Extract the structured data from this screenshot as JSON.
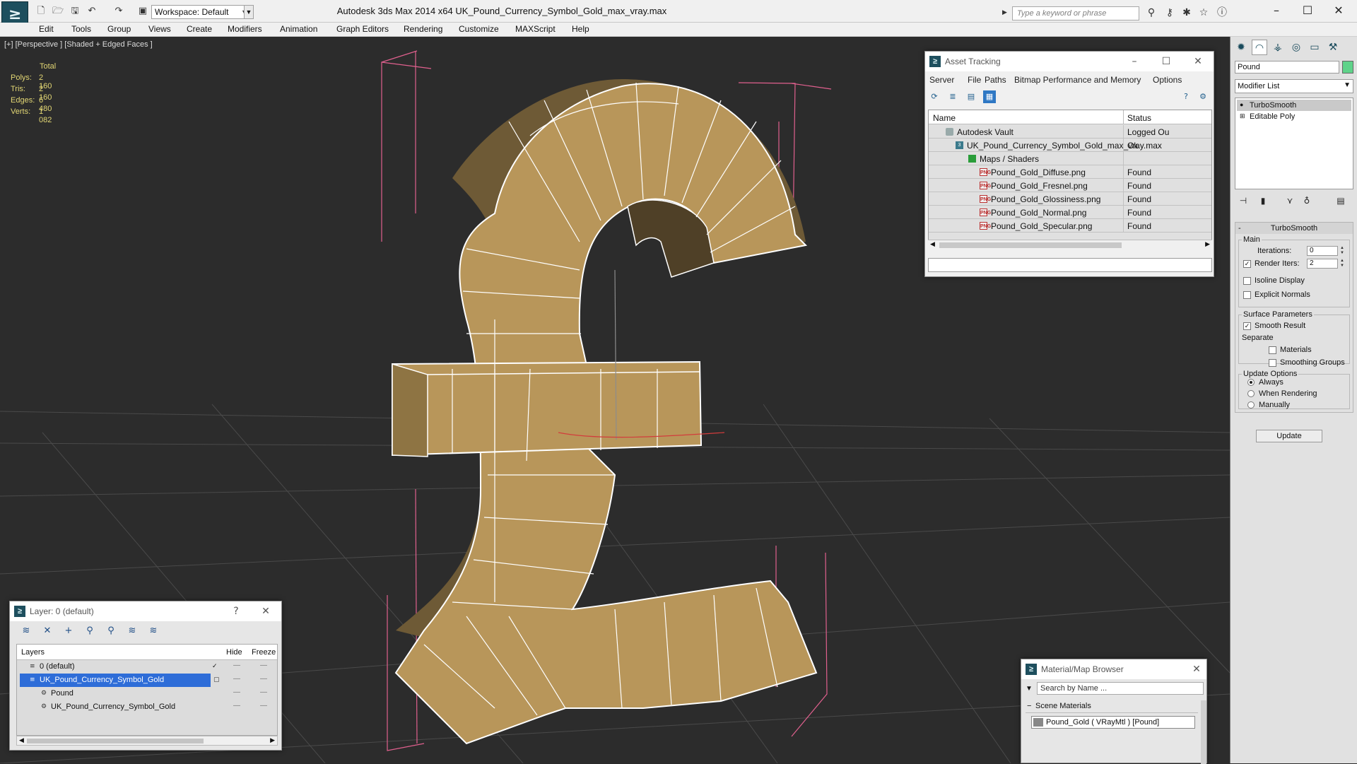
{
  "titlebar": {
    "workspace": "Workspace: Default",
    "title": "Autodesk 3ds Max  2014 x64      UK_Pound_Currency_Symbol_Gold_max_vray.max",
    "search_placeholder": "Type a keyword or phrase"
  },
  "menu": [
    "Edit",
    "Tools",
    "Group",
    "Views",
    "Create",
    "Modifiers",
    "Animation",
    "Graph Editors",
    "Rendering",
    "Customize",
    "MAXScript",
    "Help"
  ],
  "viewport": {
    "label": "[+] [Perspective ] [Shaded + Edged Faces ]",
    "stats": {
      "header": "Total",
      "rows": [
        {
          "key": "Polys:",
          "value": "2 160"
        },
        {
          "key": "Tris:",
          "value": "2 160"
        },
        {
          "key": "Edges:",
          "value": "6 480"
        },
        {
          "key": "Verts:",
          "value": "1 082"
        }
      ]
    },
    "object_color": "#b8965a",
    "wire_color": "#ffffff",
    "bbox_color": "#e0608e"
  },
  "asset_tracking": {
    "title": "Asset Tracking",
    "menu": [
      "Server",
      "File",
      "Paths",
      "Bitmap Performance and Memory",
      "Options"
    ],
    "columns": [
      "Name",
      "Status"
    ],
    "rows": [
      {
        "name": "Autodesk Vault",
        "status": "Logged Ou",
        "icon": "vault-icon"
      },
      {
        "name": "UK_Pound_Currency_Symbol_Gold_max_vray.max",
        "status": "Ok",
        "icon": "max-file-icon"
      },
      {
        "name": "Maps / Shaders",
        "status": "",
        "icon": "folder-icon"
      },
      {
        "name": "Pound_Gold_Diffuse.png",
        "status": "Found",
        "icon": "png-icon"
      },
      {
        "name": "Pound_Gold_Fresnel.png",
        "status": "Found",
        "icon": "png-icon"
      },
      {
        "name": "Pound_Gold_Glossiness.png",
        "status": "Found",
        "icon": "png-icon"
      },
      {
        "name": "Pound_Gold_Normal.png",
        "status": "Found",
        "icon": "png-icon"
      },
      {
        "name": "Pound_Gold_Specular.png",
        "status": "Found",
        "icon": "png-icon"
      }
    ]
  },
  "layers": {
    "title": "Layer: 0 (default)",
    "columns": [
      "Layers",
      "Hide",
      "Freeze"
    ],
    "rows": [
      {
        "name": "0 (default)"
      },
      {
        "name": "UK_Pound_Currency_Symbol_Gold"
      },
      {
        "name": "Pound"
      },
      {
        "name": "UK_Pound_Currency_Symbol_Gold"
      }
    ]
  },
  "command_panel": {
    "object_name": "Pound",
    "modifier_list": "Modifier List",
    "stack": [
      "TurboSmooth",
      "Editable Poly"
    ],
    "turbosmooth": {
      "title": "TurboSmooth",
      "main_label": "Main",
      "iterations_label": "Iterations:",
      "iterations": "0",
      "render_iters_label": "Render Iters:",
      "render_iters": "2",
      "isoline": "Isoline Display",
      "explicit_normals": "Explicit Normals",
      "surface_params": "Surface Parameters",
      "smooth_result": "Smooth Result",
      "separate": "Separate",
      "materials": "Materials",
      "smoothing_groups": "Smoothing Groups",
      "update_options": "Update Options",
      "always": "Always",
      "when_rendering": "When Rendering",
      "manually": "Manually",
      "update_button": "Update"
    }
  },
  "material_browser": {
    "title": "Material/Map Browser",
    "search_placeholder": "Search by Name ...",
    "section": "Scene Materials",
    "item": "Pound_Gold  ( VRayMtl )  [Pound]"
  }
}
